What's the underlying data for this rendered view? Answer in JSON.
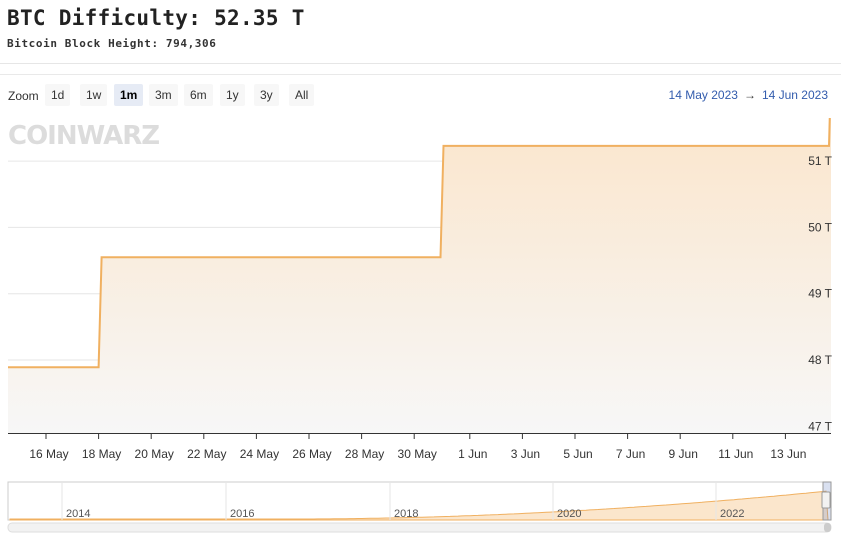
{
  "header": {
    "title": "BTC Difficulty: 52.35 T",
    "subtitle": "Bitcoin Block Height: 794,306"
  },
  "toolbar": {
    "zoom_label": "Zoom",
    "zoom_buttons": [
      "1d",
      "1w",
      "1m",
      "3m",
      "6m",
      "1y",
      "3y",
      "All"
    ],
    "active_zoom": "1m",
    "range_from": "14 May 2023",
    "range_arrow": "→",
    "range_to": "14 Jun 2023"
  },
  "watermark": "COINWARZ",
  "colors": {
    "line": "#f0b060",
    "fill_top": "#fbe3c6",
    "fill_bottom": "#f7f7f7",
    "accent_text": "#335cad"
  },
  "chart_data": {
    "type": "area",
    "title": "BTC Difficulty: 52.35 T",
    "xlabel": "",
    "ylabel": "",
    "x_ticks": [
      "16 May",
      "18 May",
      "20 May",
      "22 May",
      "24 May",
      "26 May",
      "28 May",
      "30 May",
      "1 Jun",
      "3 Jun",
      "5 Jun",
      "7 Jun",
      "9 Jun",
      "11 Jun",
      "13 Jun"
    ],
    "y_ticks": [
      "47 T",
      "48 T",
      "49 T",
      "50 T",
      "51 T"
    ],
    "ylim": [
      46.9,
      51.65
    ],
    "grid": true,
    "series": [
      {
        "points": [
          [
            "2023-05-14",
            47.89
          ],
          [
            "2023-05-18",
            47.89
          ],
          [
            "2023-05-18",
            49.55
          ],
          [
            "2023-05-31",
            49.55
          ],
          [
            "2023-05-31",
            51.23
          ],
          [
            "2023-06-14",
            51.23
          ],
          [
            "2023-06-14",
            52.35
          ]
        ]
      }
    ],
    "navigator": {
      "x_ticks": [
        "2014",
        "2016",
        "2018",
        "2020",
        "2022"
      ]
    }
  }
}
